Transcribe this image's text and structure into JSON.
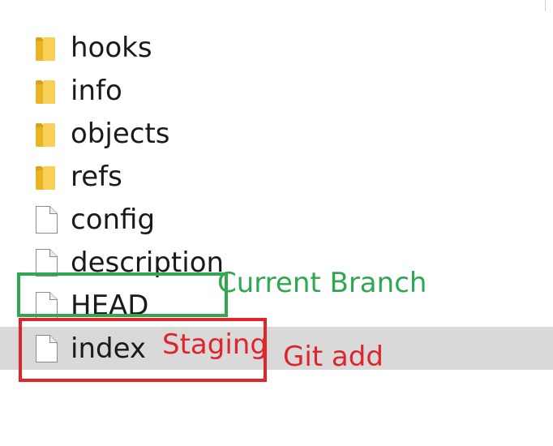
{
  "entries": [
    {
      "label": "hooks",
      "type": "folder"
    },
    {
      "label": "info",
      "type": "folder"
    },
    {
      "label": "objects",
      "type": "folder"
    },
    {
      "label": "refs",
      "type": "folder"
    },
    {
      "label": "config",
      "type": "file"
    },
    {
      "label": "description",
      "type": "file"
    },
    {
      "label": "HEAD",
      "type": "file"
    },
    {
      "label": "index",
      "type": "file",
      "selected": true
    }
  ],
  "annotations": {
    "current_branch": "Current Branch",
    "staging": "Staging",
    "git_add": "Git add"
  },
  "colors": {
    "green": "#2fa84f",
    "red": "#e0242b",
    "selection": "#d9d9d9",
    "folder": "#f5c542"
  },
  "icons": {
    "folder": "folder-icon",
    "file": "file-icon"
  }
}
